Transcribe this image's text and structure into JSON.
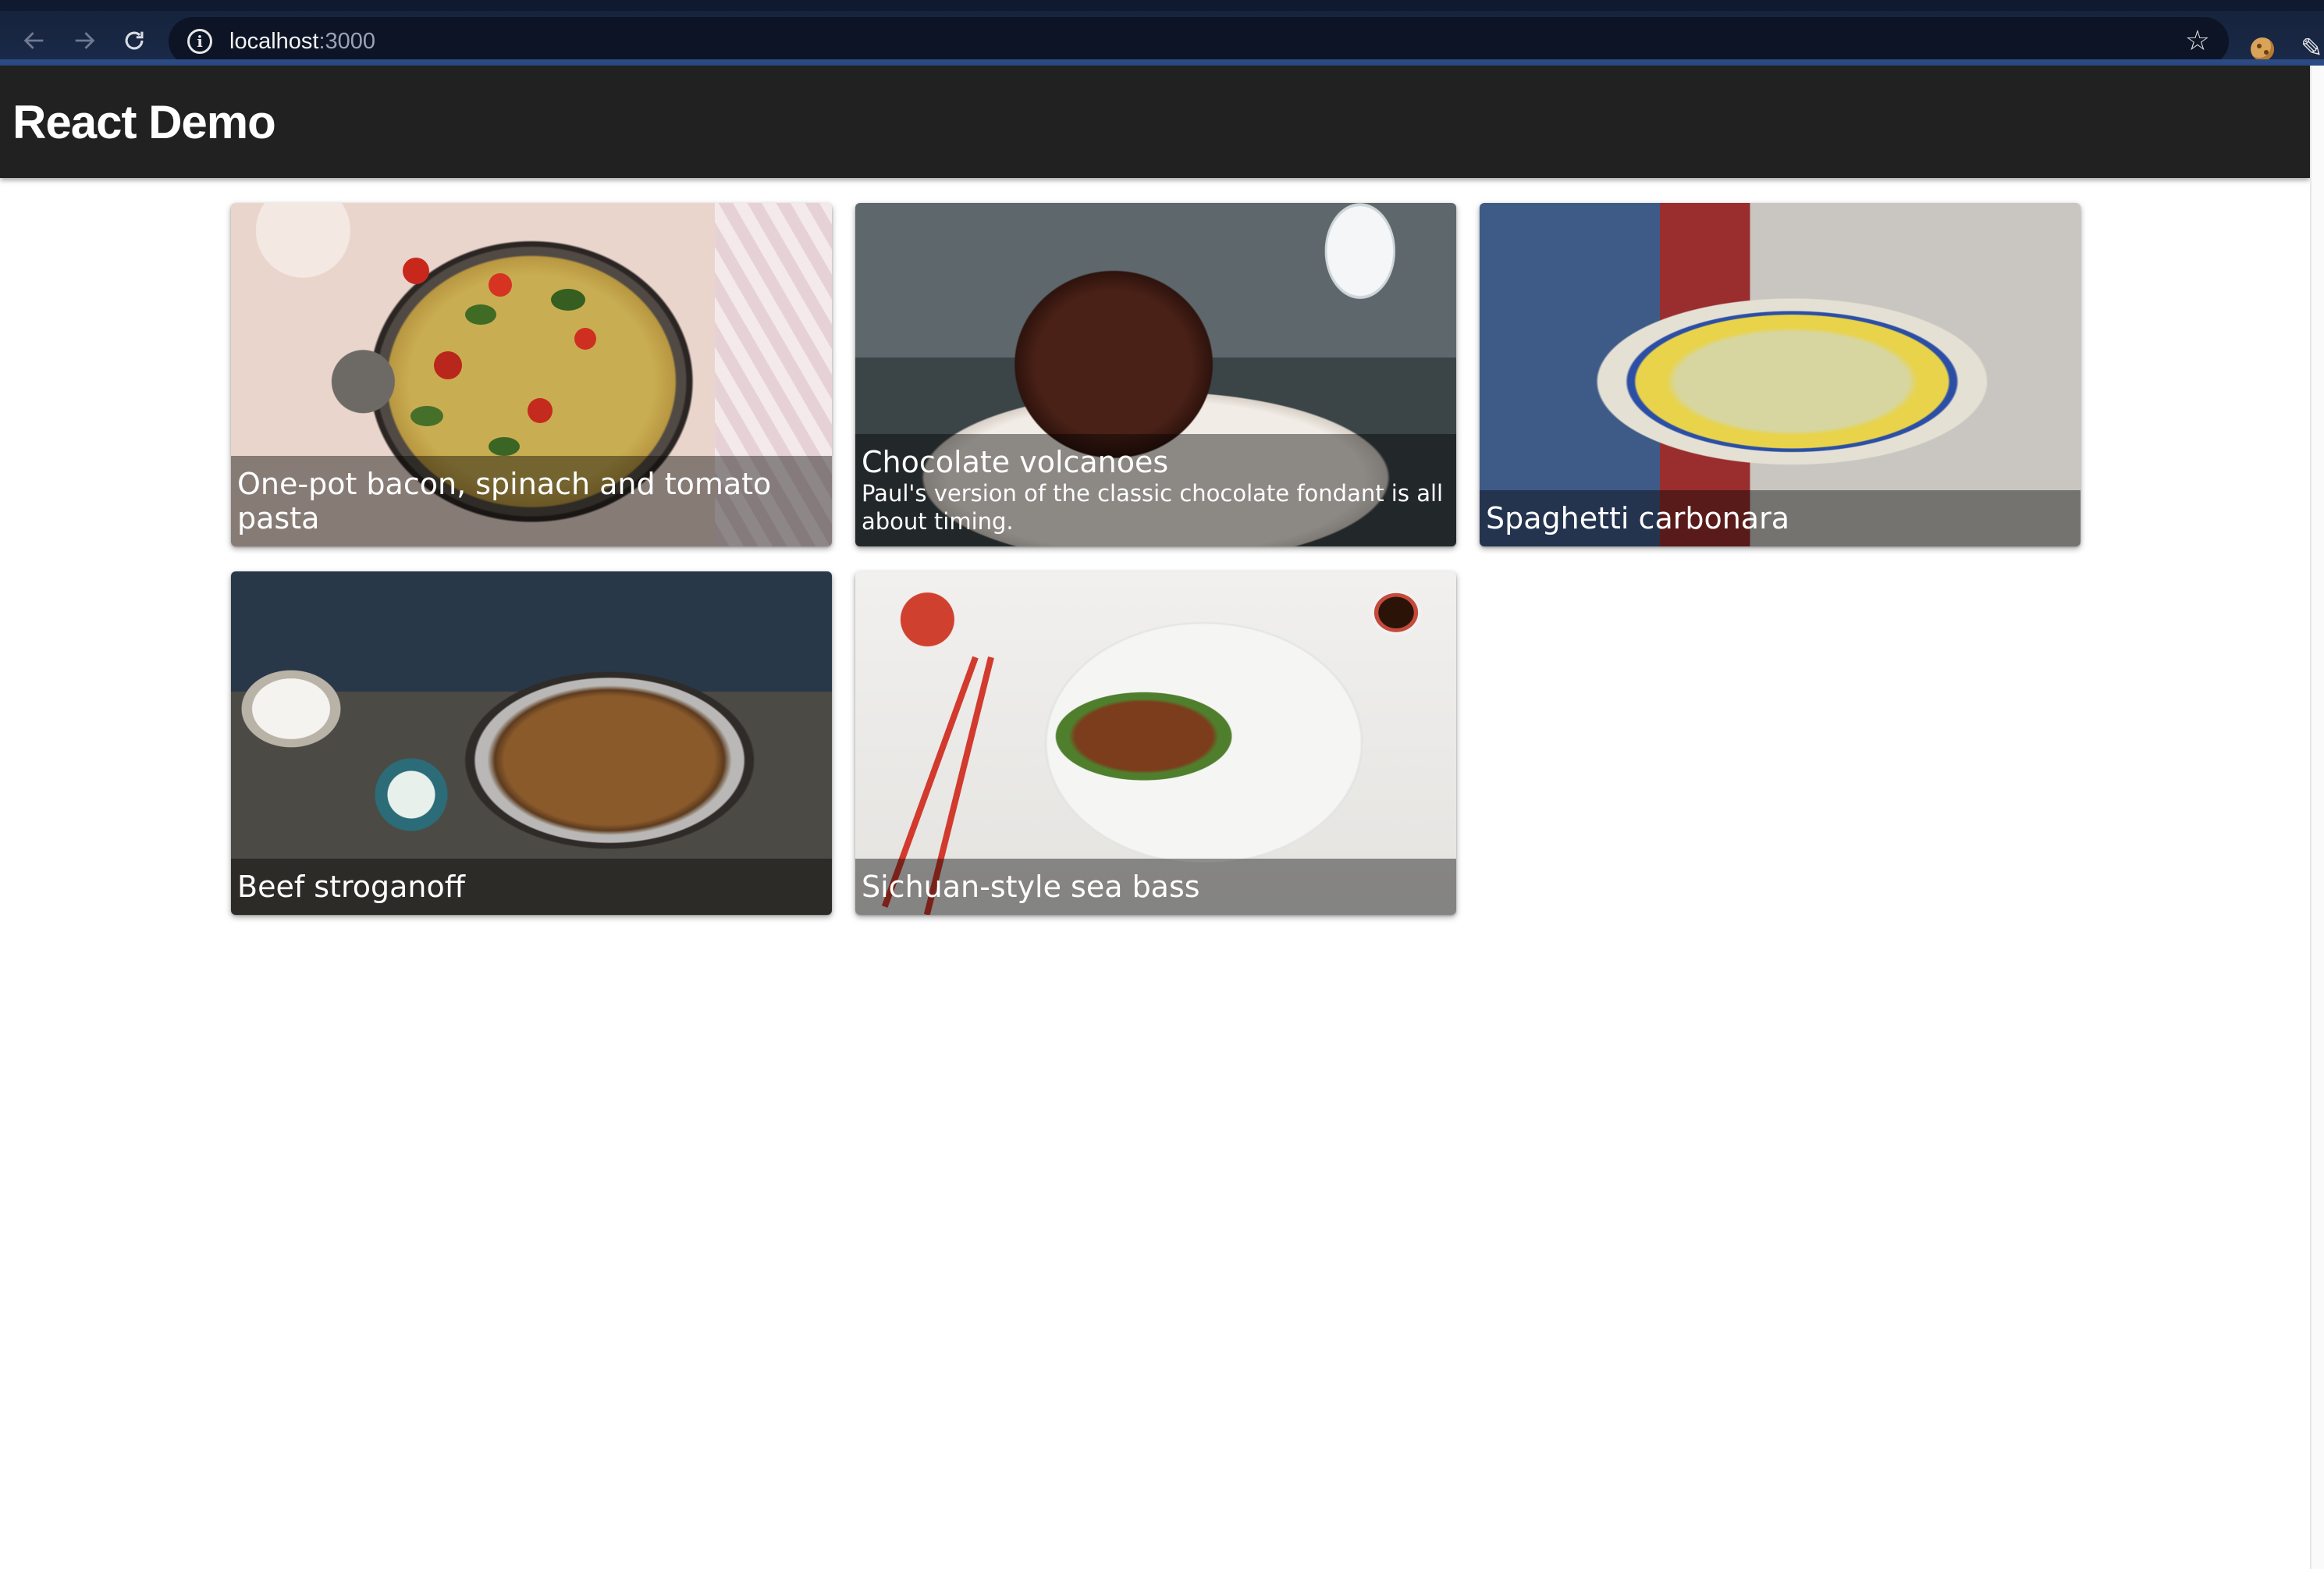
{
  "browser": {
    "url_host": "localhost",
    "url_port": ":3000",
    "icons": {
      "back": "arrow-left-icon",
      "forward": "arrow-right-icon",
      "reload": "reload-icon",
      "info": "info-icon",
      "bookmark": "star-icon",
      "extension_1": "cookie-icon",
      "extension_2": "pen-icon"
    }
  },
  "app": {
    "title": "React Demo",
    "header_color": "#212121"
  },
  "recipes": [
    {
      "title": "One-pot bacon, spinach and tomato pasta",
      "description": ""
    },
    {
      "title": "Chocolate volcanoes",
      "description": "Paul's version of the classic chocolate fondant is all about timing."
    },
    {
      "title": "Spaghetti carbonara",
      "description": ""
    },
    {
      "title": "Beef stroganoff",
      "description": ""
    },
    {
      "title": "Sichuan-style sea bass",
      "description": ""
    }
  ]
}
